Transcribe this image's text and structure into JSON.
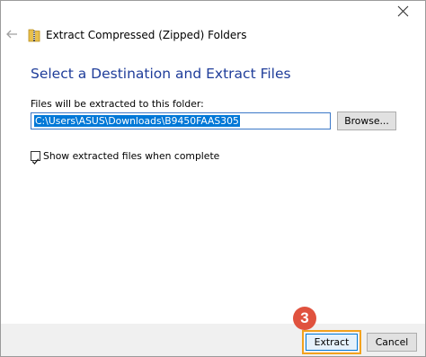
{
  "window": {
    "title": "Extract Compressed (Zipped) Folders"
  },
  "main": {
    "heading": "Select a Destination and Extract Files",
    "destination_label": "Files will be extracted to this folder:",
    "destination_path": "C:\\Users\\ASUS\\Downloads\\B9450FAAS305",
    "browse_label": "Browse...",
    "show_files_label": "Show extracted files when complete",
    "show_files_checked": true
  },
  "footer": {
    "extract_label": "Extract",
    "cancel_label": "Cancel"
  },
  "annotation": {
    "step_number": "3",
    "badge_color": "#e0523e",
    "highlight_color": "#f3a21d"
  },
  "icons": {
    "back": "back-arrow-icon",
    "folder": "zipped-folder-icon",
    "close": "close-icon",
    "check": "checkmark-icon"
  },
  "colors": {
    "heading": "#1f3d9a",
    "selection": "#0078d7",
    "footer_bg": "#f0f0f0"
  }
}
